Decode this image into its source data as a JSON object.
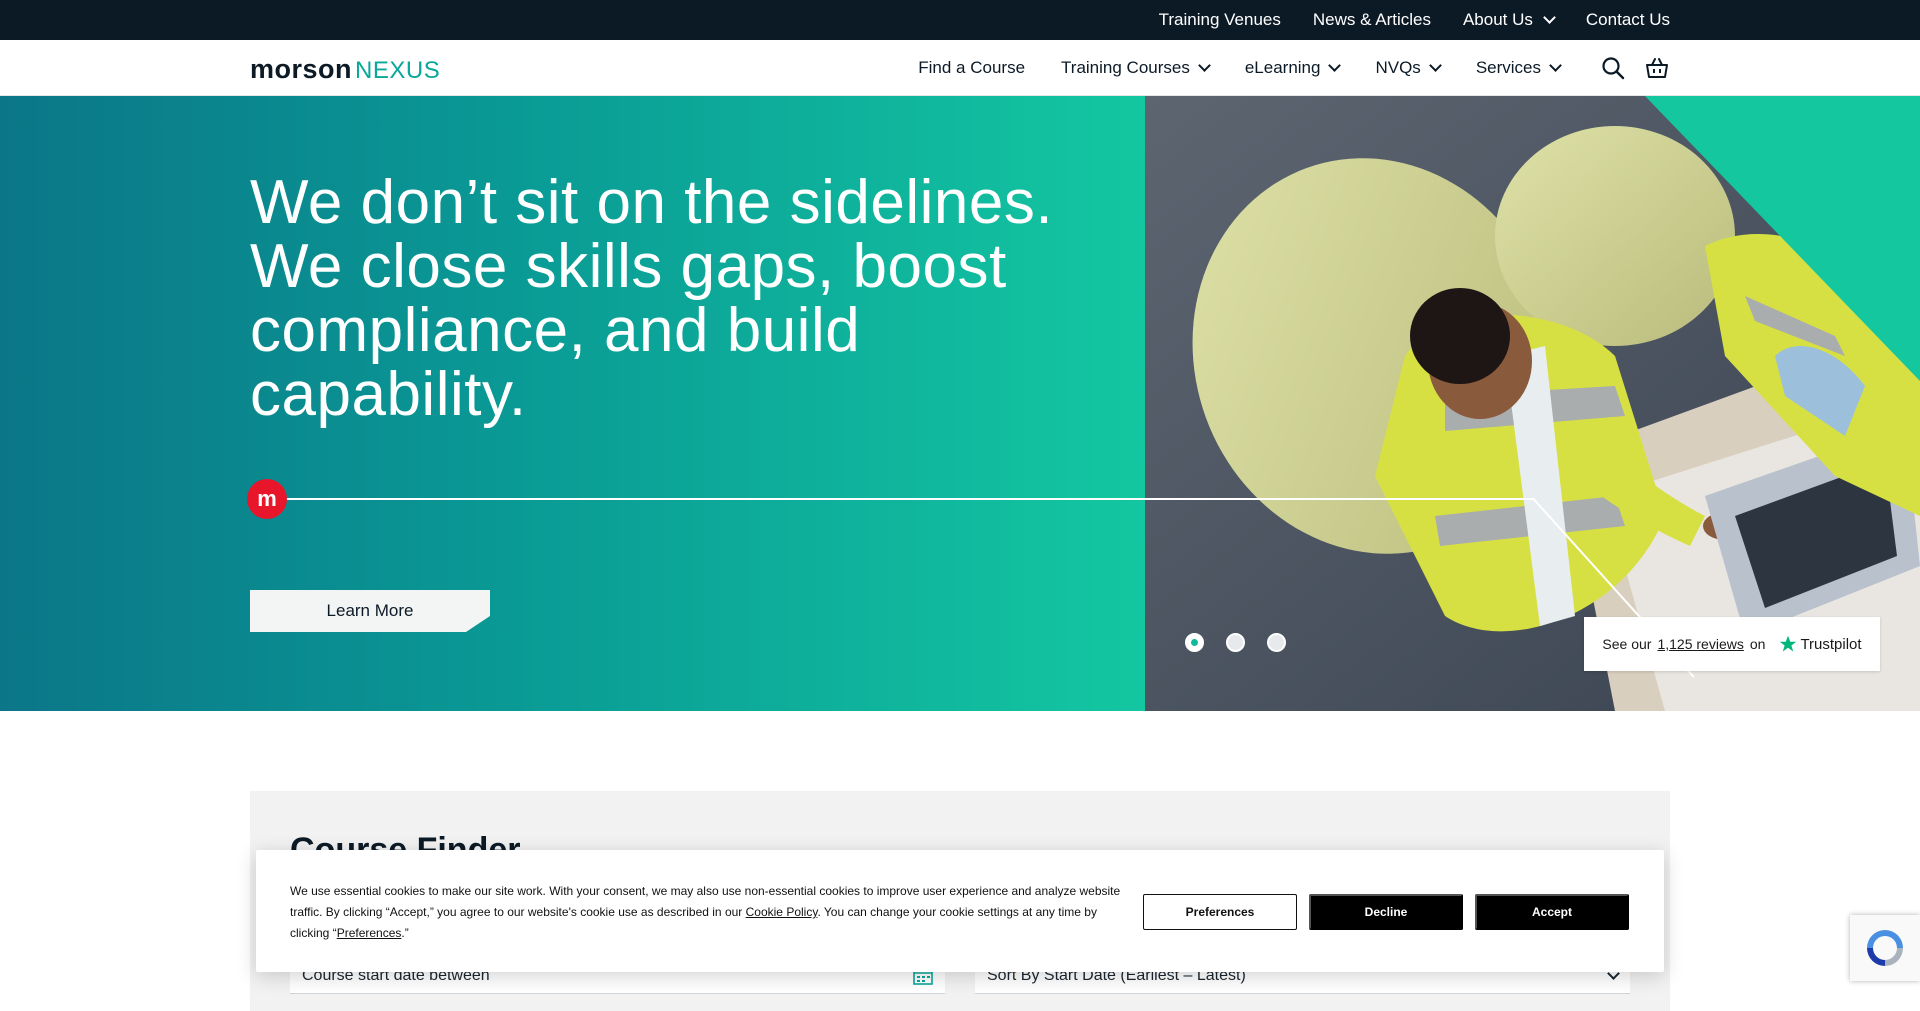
{
  "topbar": {
    "links": [
      {
        "label": "Training Venues",
        "has_dropdown": false
      },
      {
        "label": "News & Articles",
        "has_dropdown": false
      },
      {
        "label": "About Us",
        "has_dropdown": true
      },
      {
        "label": "Contact Us",
        "has_dropdown": false
      }
    ]
  },
  "header": {
    "logo_part1": "morson",
    "logo_part2": "NEXUS",
    "nav": [
      {
        "label": "Find a Course",
        "has_dropdown": false
      },
      {
        "label": "Training Courses",
        "has_dropdown": true
      },
      {
        "label": "eLearning",
        "has_dropdown": true
      },
      {
        "label": "NVQs",
        "has_dropdown": true
      },
      {
        "label": "Services",
        "has_dropdown": true
      }
    ],
    "icons": [
      "search-icon",
      "basket-icon"
    ]
  },
  "hero": {
    "title": "We don’t sit on the sidelines. We close skills gaps, boost compliance, and build capability.",
    "badge_letter": "m",
    "cta_label": "Learn More",
    "carousel": {
      "slide_count": 3,
      "active_index": 0
    },
    "trustpilot": {
      "prefix": "See our",
      "review_count": "1,125 reviews",
      "suffix": "on",
      "brand": "Trustpilot"
    }
  },
  "course_finder": {
    "title": "Course Finder",
    "date_field_label": "Course start date between",
    "sort_select_value": "Sort By Start Date (Earliest – Latest)"
  },
  "cookie_banner": {
    "text_part1": "We use essential cookies to make our site work. With your consent, we may also use non-essential cookies to improve user experience and analyze website traffic. By clicking “Accept,” you agree to our website's cookie use as described in our ",
    "policy_link": "Cookie Policy",
    "text_part2": ". You can change your cookie settings at any time by clicking “",
    "preferences_link": "Preferences",
    "text_part3": ".”",
    "buttons": {
      "preferences": "Preferences",
      "decline": "Decline",
      "accept": "Accept"
    }
  },
  "colors": {
    "topbar_bg": "#0c1a26",
    "brand_teal": "#0aa89a",
    "hero_gradient_start": "#0b7688",
    "hero_gradient_end": "#13c7a1",
    "badge_red": "#e8162a",
    "trustpilot_green": "#00b67a"
  }
}
